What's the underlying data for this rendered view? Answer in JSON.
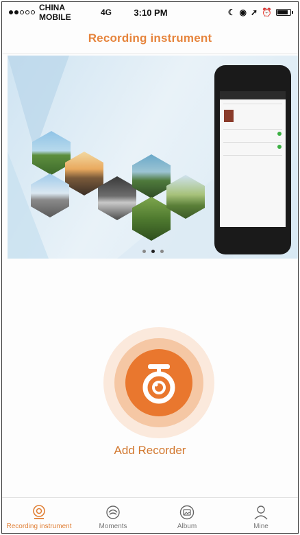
{
  "status_bar": {
    "carrier": "CHINA MOBILE",
    "network": "4G",
    "time": "3:10 PM"
  },
  "nav": {
    "title": "Recording instrument"
  },
  "banner": {
    "pages": 3,
    "active_page": 2
  },
  "main": {
    "add_label": "Add Recorder"
  },
  "tabs": [
    {
      "label": "Recording instrument",
      "icon": "camera-icon",
      "active": true
    },
    {
      "label": "Moments",
      "icon": "moments-icon",
      "active": false
    },
    {
      "label": "Album",
      "icon": "album-icon",
      "active": false
    },
    {
      "label": "Mine",
      "icon": "person-icon",
      "active": false
    }
  ],
  "colors": {
    "accent": "#e6843c",
    "accent_dark": "#e9772e",
    "ring_mid": "#f5c7a4",
    "ring_outer": "#fbe9dc"
  }
}
